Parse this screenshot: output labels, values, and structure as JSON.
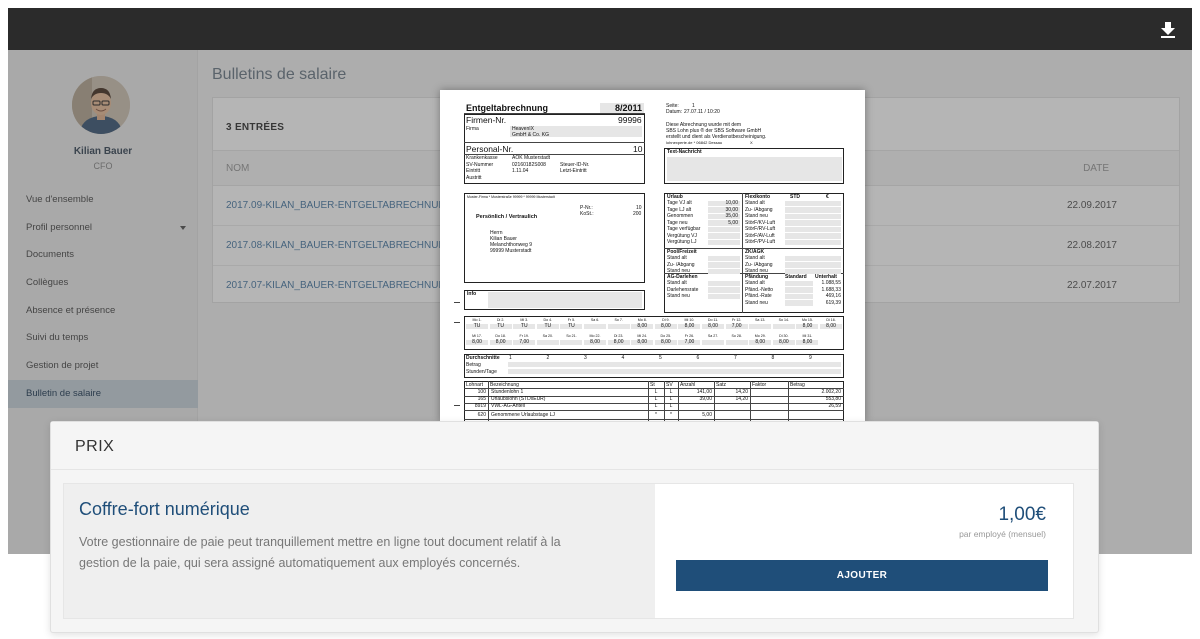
{
  "topbar": {
    "download_icon": "download-icon"
  },
  "user": {
    "name": "Kilian Bauer",
    "role": "CFO"
  },
  "nav": [
    {
      "label": "Vue d'ensemble"
    },
    {
      "label": "Profil personnel",
      "has_submenu": true
    },
    {
      "label": "Documents"
    },
    {
      "label": "Collègues"
    },
    {
      "label": "Absence et présence"
    },
    {
      "label": "Suivi du temps"
    },
    {
      "label": "Gestion de projet"
    },
    {
      "label": "Bulletin de salaire",
      "active": true
    }
  ],
  "page": {
    "title": "Bulletins de salaire",
    "entries": "3 ENTRÉES",
    "columns": {
      "name": "NOM",
      "date": "DATE"
    },
    "rows": [
      {
        "file": "2017.09-KILAN_BAUER-ENTGELTABRECHNUNG.PDF",
        "date": "22.09.2017"
      },
      {
        "file": "2017.08-KILAN_BAUER-ENTGELTABRECHNUNG.PDF",
        "date": "22.08.2017"
      },
      {
        "file": "2017.07-KILAN_BAUER-ENTGELTABRECHNUNG.PDF",
        "date": "22.07.2017"
      }
    ]
  },
  "doc": {
    "title": "Entgeltabrechnung",
    "period": "8/2011",
    "seite_label": "Seite:",
    "seite": "1",
    "datum_label": "Datum:",
    "datum": "27.07.11 / 10:20",
    "note1": "Diese Abrechnung wurde mit dem",
    "note2": "SBS Lohn plus ® der SBS Software GmbH",
    "note3": "erstellt und dient als Verdienstbescheinigung.",
    "note4": "lohnexperte.de * 06842 Dessau",
    "note4b": "X",
    "firmen_label": "Firmen-Nr.",
    "firmen_nr": "99996",
    "firma_label": "Firma",
    "firma1": "HeavenIX",
    "firma2": "GmbH & Co. KG",
    "personal_label": "Personal-Nr.",
    "personal_nr": "10",
    "krankenkasse_label": "Krankenkasse",
    "krankenkasse": "AOK Musterstadt",
    "sv_label": "SV-Nummer",
    "sv": "02160182S008",
    "steuer_label": "Steuer-ID-Nr.",
    "eintritt_label": "Eintritt",
    "eintritt": "1.11.04",
    "letzt_label": "Letzt-Eintritt",
    "austritt_label": "Austritt",
    "text_nachricht": "Text-Nachricht",
    "addr_head": "Muster-Firma * Musterstraße 99999 * 99999 Musterstadt",
    "pnr_label": "P-Nr.:",
    "pnr": "10",
    "kost_label": "KoSt.:",
    "kost": "200",
    "confidential": "Persönlich / Vertraulich",
    "addr": [
      "Herrn",
      "Kilian Bauer",
      "Melanchthonweg 9",
      "99999 Musterstadt"
    ],
    "info": "Info",
    "urlaub_head": "Urlaub",
    "urlaub": [
      {
        "label": "Tage VJ alt",
        "value": "10,00"
      },
      {
        "label": "Tage LJ alt",
        "value": "30,00"
      },
      {
        "label": "Genommen",
        "value": "35,00"
      },
      {
        "label": "Tage neu",
        "value": "5,00"
      },
      {
        "label": "Tage verfügbar",
        "value": ""
      },
      {
        "label": "Vergütung VJ",
        "value": ""
      },
      {
        "label": "Vergütung LJ",
        "value": ""
      }
    ],
    "flexi_head": "Flexikonto",
    "std_head": "STD",
    "eur_head": "€",
    "flexi": [
      "Stand alt",
      "Zu- /Abgang",
      "Stand neu",
      "StörF/KV-Luft",
      "StörF/RV-Luft",
      "StörF/AV-Luft",
      "StörF/PV-Luft"
    ],
    "pool_head": "Pool/Freizeit",
    "pool": [
      "Stand alt",
      "Zu- /Abgang",
      "Stand neu"
    ],
    "zk_head": "ZK/AGK",
    "zk": [
      "Stand alt",
      "Zu- /Abgang",
      "Stand neu"
    ],
    "ag_head": "AG-Darlehen",
    "ag": [
      "Stand alt",
      "Darlehensrate",
      "Stand neu"
    ],
    "pfaend_head": "Pfändung",
    "standard_head": "Standard",
    "unterhalt_head": "Unterhalt",
    "pfaend": [
      {
        "label": "Stand alt",
        "value": "1.088,55"
      },
      {
        "label": "Pfänd.-Netto",
        "value": "1.688,33"
      },
      {
        "label": "Pfänd.-Rate",
        "value": "469,16"
      },
      {
        "label": "Stand neu",
        "value": "619,39"
      }
    ],
    "cal_row1": [
      {
        "d": "Mo 1.",
        "w": "TU"
      },
      {
        "d": "Di 2.",
        "w": "TU"
      },
      {
        "d": "Mi 3.",
        "w": "TU"
      },
      {
        "d": "Do 4.",
        "w": "TU"
      },
      {
        "d": "Fr 5.",
        "w": "TU"
      },
      {
        "d": "Sa 6.",
        "w": ""
      },
      {
        "d": "So 7.",
        "w": ""
      },
      {
        "d": "Mo 8.",
        "w": "8,00"
      },
      {
        "d": "Di 9.",
        "w": "8,00"
      },
      {
        "d": "Mi 10.",
        "w": "8,00"
      },
      {
        "d": "Do 11.",
        "w": "8,00"
      },
      {
        "d": "Fr 12.",
        "w": "7,00"
      },
      {
        "d": "Sa 13.",
        "w": ""
      },
      {
        "d": "So 14.",
        "w": ""
      },
      {
        "d": "Mo 15.",
        "w": "8,00"
      },
      {
        "d": "Di 16.",
        "w": "8,00"
      }
    ],
    "cal_row2": [
      {
        "d": "Mi 17.",
        "w": "8,00"
      },
      {
        "d": "Do 18.",
        "w": "8,00"
      },
      {
        "d": "Fr 19.",
        "w": "7,00"
      },
      {
        "d": "Sa 20.",
        "w": ""
      },
      {
        "d": "So 21.",
        "w": ""
      },
      {
        "d": "Mo 22.",
        "w": "8,00"
      },
      {
        "d": "Di 23.",
        "w": "8,00"
      },
      {
        "d": "Mi 24.",
        "w": "8,00"
      },
      {
        "d": "Do 25.",
        "w": "8,00"
      },
      {
        "d": "Fr 26.",
        "w": "7,00"
      },
      {
        "d": "Sa 27.",
        "w": ""
      },
      {
        "d": "So 28.",
        "w": ""
      },
      {
        "d": "Mo 29.",
        "w": "8,00"
      },
      {
        "d": "Di 30.",
        "w": "8,00"
      },
      {
        "d": "Mi 31.",
        "w": "8,00"
      }
    ],
    "durch_head": "Durchschnitte",
    "durch_cols": [
      "1",
      "2",
      "3",
      "4",
      "5",
      "6",
      "7",
      "8",
      "9"
    ],
    "durch_rows": [
      "Betrag",
      "Stunden/Tage"
    ],
    "lohn_cols": [
      "Lohnart",
      "Bezeichnung",
      "St",
      "SV",
      "Anzahl",
      "Satz",
      "Faktor",
      "Betrag"
    ],
    "lohn_rows": [
      {
        "nr": "100",
        "name": "Stundenlohn 1",
        "st": "L",
        "sv": "L",
        "anz": "141,00",
        "satz": "14,20",
        "betrag": "2.002,20"
      },
      {
        "nr": "165",
        "name": "Urlaubslohn (STDxEUR)",
        "st": "L",
        "sv": "L",
        "anz": "39,00",
        "satz": "14,20",
        "betrag": "553,80"
      },
      {
        "nr": "8919",
        "name": "VWL-AG-Anteil",
        "st": "L",
        "sv": "L",
        "anz": "",
        "satz": "",
        "betrag": "26,59"
      },
      {
        "nr": "620",
        "name": "Genommene Urlaubstage LJ",
        "st": "*",
        "sv": "*",
        "anz": "5,00",
        "satz": "",
        "betrag": ""
      }
    ]
  },
  "pricing": {
    "header": "PRIX",
    "title": "Coffre-fort numérique",
    "description": "Votre gestionnaire de paie peut tranquillement mettre en ligne tout document relatif à la gestion de la paie, qui sera assigné automatiquement aux employés concernés.",
    "price": "1,00€",
    "unit": "par employé (mensuel)",
    "button": "AJOUTER"
  },
  "colors": {
    "accent": "#1f4e79",
    "link": "#4d7ca6",
    "topbar": "#2b2b2b"
  }
}
